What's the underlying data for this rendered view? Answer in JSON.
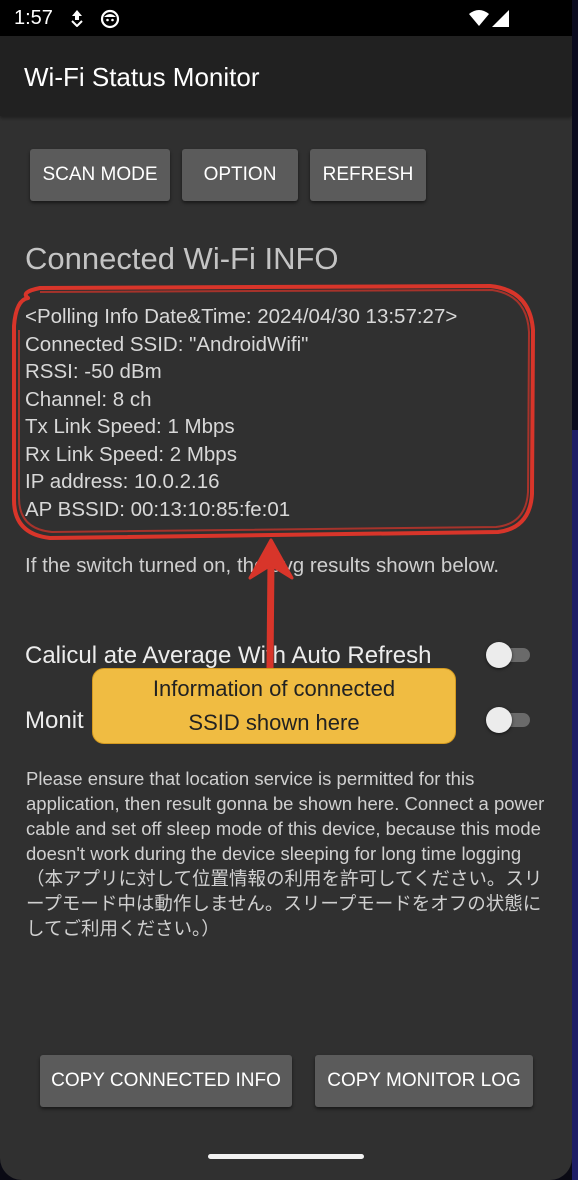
{
  "status_bar": {
    "time": "1:57",
    "icons": [
      "data-saver-icon",
      "face-icon",
      "wifi-icon",
      "signal-icon"
    ]
  },
  "app": {
    "title": "Wi-Fi Status Monitor"
  },
  "toolbar": {
    "scan_mode": "SCAN MODE",
    "option": "OPTION",
    "refresh": "REFRESH"
  },
  "info": {
    "heading": "Connected Wi-Fi INFO",
    "lines": [
      "<Polling Info Date&Time: 2024/04/30 13:57:27>",
      "Connected SSID: \"AndroidWifi\"",
      "RSSI: -50 dBm",
      "Channel: 8 ch",
      "Tx Link Speed: 1 Mbps",
      "Rx Link Speed: 2 Mbps",
      "IP address: 10.0.2.16",
      "AP BSSID: 00:13:10:85:fe:01"
    ]
  },
  "note": "If the switch turned on, the avg results shown below.",
  "switches": {
    "average_label": "Calicul ate Average With Auto Refresh",
    "average_on": false,
    "monitor_label": "Monit",
    "monitor_on": false
  },
  "disclaimer": "Please ensure that location service is permitted for this application, then result gonna be shown here. Connect a power cable and set off sleep mode of this device, because this mode doesn't work during the device sleeping for long time logging（本アプリに対して位置情報の利用を許可してください。スリープモード中は動作しません。スリープモードをオフの状態にしてご利用ください。）",
  "bottom_buttons": {
    "copy_info": "COPY CONNECTED INFO",
    "copy_log": "COPY MONITOR LOG"
  },
  "annotation": {
    "callout_line1": "Information of connected",
    "callout_line2": "SSID shown here"
  },
  "colors": {
    "background": "#303030",
    "app_bar": "#212121",
    "button": "#5b5b5b",
    "annotation_red": "#d8352a",
    "callout_fill": "#f0bc42"
  }
}
